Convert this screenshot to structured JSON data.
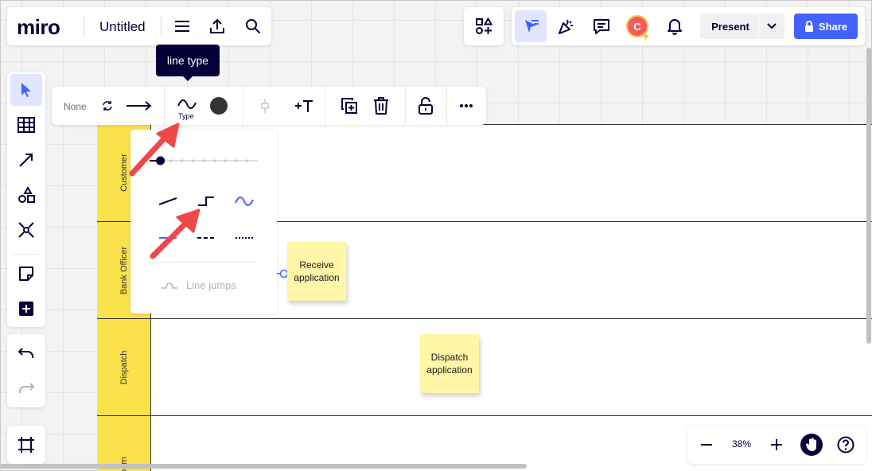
{
  "app": {
    "logo_text": "miro",
    "board_title": "Untitled"
  },
  "header": {
    "present_label": "Present",
    "share_label": "Share",
    "avatar_initial": "C"
  },
  "tooltip": {
    "text": "line type"
  },
  "context_toolbar": {
    "start_cap_label": "None",
    "type_label": "Type"
  },
  "line_panel": {
    "line_jumps_label": "Line jumps",
    "thickness_level": 1,
    "thickness_steps": 10
  },
  "lanes": [
    {
      "label": "Customer"
    },
    {
      "label": "Bank Officer"
    },
    {
      "label": "Dispatch"
    },
    {
      "label": "oom"
    }
  ],
  "stickies": [
    {
      "text": "Receive application"
    },
    {
      "text": "Dispatch application"
    }
  ],
  "zoom": {
    "level": "38%"
  },
  "colors": {
    "accent": "#4262ff",
    "lane_header": "#fce24a",
    "sticky": "#fff6a8",
    "annotation_arrow": "#f04848",
    "ink": "#050038"
  }
}
